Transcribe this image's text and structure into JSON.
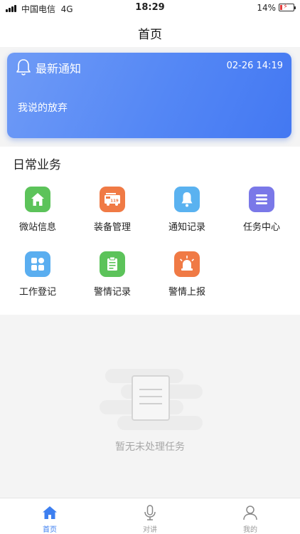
{
  "status_bar": {
    "carrier": "中国电信",
    "network": "4G",
    "time": "18:29",
    "battery": "14%",
    "battery_level": 0.14
  },
  "nav": {
    "title": "首页"
  },
  "notice": {
    "title": "最新通知",
    "time": "02-26 14:19",
    "content": "我说的放弃",
    "icon": "bell-icon",
    "colors": {
      "from": "#6f9bf6",
      "to": "#4378f2"
    }
  },
  "business": {
    "title": "日常业务",
    "items": [
      {
        "label": "微站信息",
        "icon": "home-icon",
        "color": "#5cc35a"
      },
      {
        "label": "装备管理",
        "icon": "fire-truck-icon",
        "color": "#f07a45"
      },
      {
        "label": "通知记录",
        "icon": "bell-icon",
        "color": "#5ab2f0"
      },
      {
        "label": "任务中心",
        "icon": "list-icon",
        "color": "#7a78e8"
      },
      {
        "label": "工作登记",
        "icon": "grid-icon",
        "color": "#5aaef0"
      },
      {
        "label": "警情记录",
        "icon": "clipboard-icon",
        "color": "#5cc35a"
      },
      {
        "label": "警情上报",
        "icon": "alarm-light-icon",
        "color": "#f07a45"
      }
    ]
  },
  "empty": {
    "text": "暂无未处理任务"
  },
  "tabs": [
    {
      "label": "首页",
      "icon": "home-icon",
      "active": true
    },
    {
      "label": "对讲",
      "icon": "microphone-icon",
      "active": false
    },
    {
      "label": "我的",
      "icon": "user-icon",
      "active": false
    }
  ],
  "colors": {
    "accent": "#3d7ff0",
    "background": "#f4f4f4"
  }
}
